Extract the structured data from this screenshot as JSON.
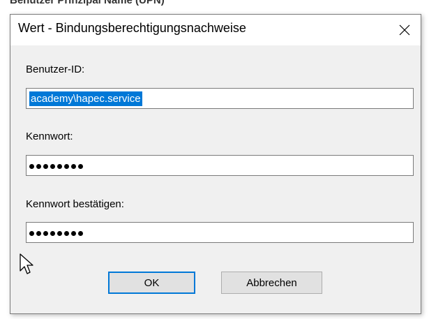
{
  "background": {
    "partial_text": "Benutzer Prinzipal Name (UPN)"
  },
  "dialog": {
    "title": "Wert - Bindungsberechtigungsnachweise",
    "fields": {
      "user_id": {
        "label": "Benutzer-ID:",
        "value": "academy\\hapec.service"
      },
      "password": {
        "label": "Kennwort:",
        "masked_length": 8
      },
      "confirm_password": {
        "label": "Kennwort bestätigen:",
        "masked_length": 8
      }
    },
    "buttons": {
      "ok_label": "OK",
      "cancel_label": "Abbrechen"
    }
  },
  "colors": {
    "selection": "#0078d7",
    "dialog_bg": "#f0f0f0",
    "button_bg": "#e1e1e1"
  },
  "icons": {
    "close": "close-icon",
    "cursor": "mouse-pointer-icon"
  }
}
